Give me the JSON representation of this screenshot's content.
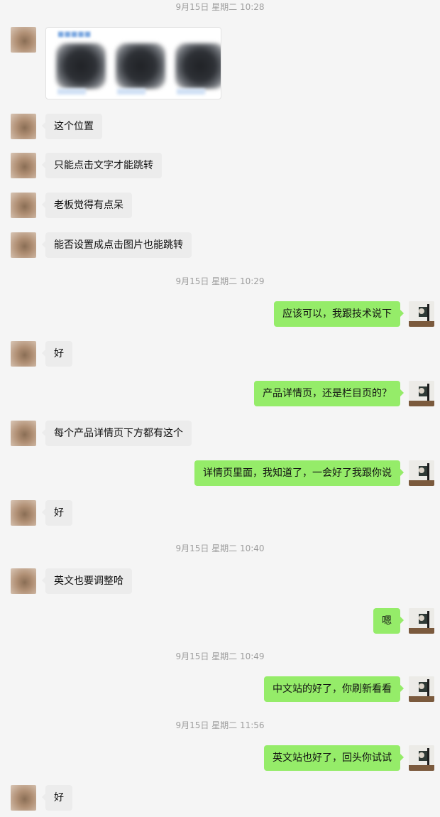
{
  "timestamps": [
    "9月15日 星期二 10:28",
    "9月15日 星期二 10:29",
    "9月15日 星期二 10:40",
    "9月15日 星期二 10:49",
    "9月15日 星期二 11:56"
  ],
  "messages": [
    "这个位置",
    "只能点击文字才能跳转",
    "老板觉得有点呆",
    "能否设置成点击图片也能跳转",
    "应该可以，我跟技术说下",
    "好",
    "产品详情页，还是栏目页的？",
    "每个产品详情页下方都有这个",
    "详情页里面，我知道了，一会好了我跟你说",
    "好",
    "英文也要调整哈",
    "嗯",
    "中文站的好了，你刷新看看",
    "英文站也好了，回头你试试",
    "好"
  ],
  "colors": {
    "self_bubble": "#95ec69",
    "other_bubble": "#ececec",
    "background": "#f5f5f5"
  }
}
